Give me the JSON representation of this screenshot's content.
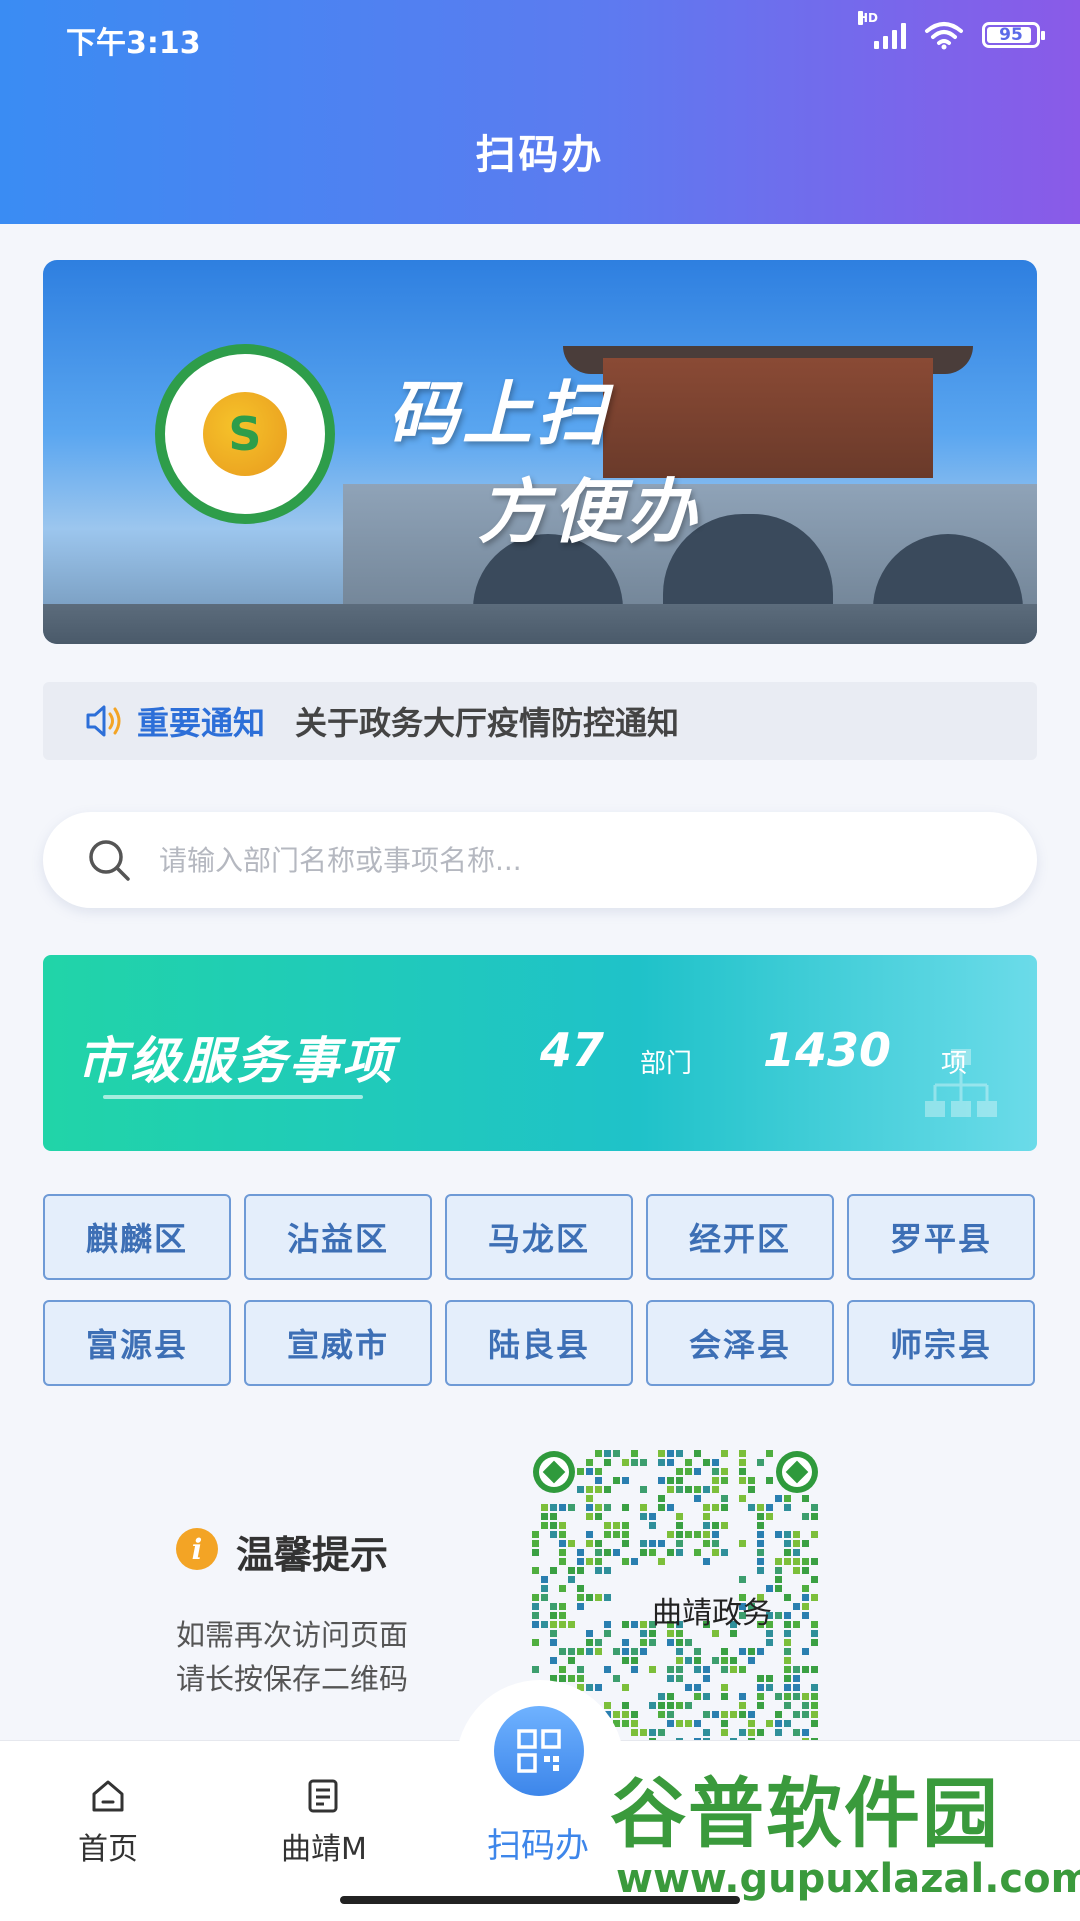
{
  "status_bar": {
    "time": "下午3:13",
    "signal_label": "HD",
    "battery": "95"
  },
  "header": {
    "title": "扫码办"
  },
  "banner": {
    "slogan_line1": "码上扫",
    "slogan_line2": "方便办",
    "logo_symbol": "S"
  },
  "notice": {
    "label": "重要通知",
    "text": "关于政务大厅疫情防控通知"
  },
  "search": {
    "placeholder": "请输入部门名称或事项名称..."
  },
  "services": {
    "title": "市级服务事项",
    "departments_count": "47",
    "departments_unit": "部门",
    "items_count": "1430",
    "items_unit": "项"
  },
  "districts": [
    "麒麟区",
    "沾益区",
    "马龙区",
    "经开区",
    "罗平县",
    "富源县",
    "宣威市",
    "陆良县",
    "会泽县",
    "师宗县"
  ],
  "tips": {
    "icon": "i",
    "title": "温馨提示",
    "line1": "如需再次访问页面",
    "line2": "请长按保存二维码"
  },
  "qr": {
    "caption": "曲靖政务"
  },
  "tabbar": {
    "home": "首页",
    "qujing_m": "曲靖M",
    "scan": "扫码办"
  },
  "watermark": {
    "title": "谷普软件园",
    "url": "www.gupuxlazal.com"
  },
  "colors": {
    "accent": "#3d86ea",
    "header_start": "#3a8cf3",
    "header_end": "#8a5ae8",
    "teal": "#21d4a8"
  }
}
